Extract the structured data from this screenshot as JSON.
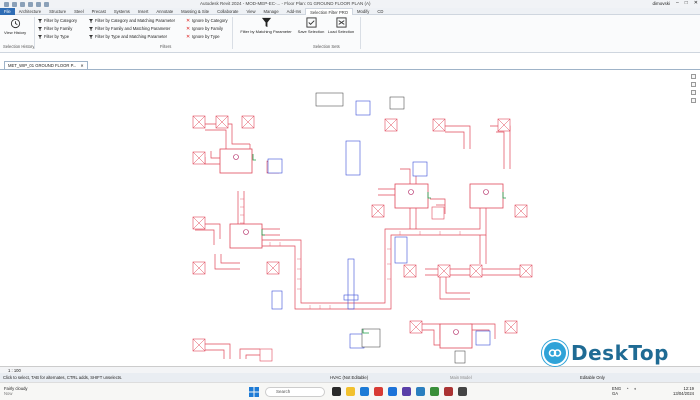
{
  "titlebar": {
    "title": "Autodesk Revit 2024 - MOD-MEP-EC-... - Floor Plan: 01 GROUND FLOOR PLAN (A)",
    "user": "dimovski",
    "qat_icons": [
      "open-icon",
      "save-icon",
      "undo-icon",
      "redo-icon",
      "print-icon",
      "measure-icon"
    ]
  },
  "tabs": [
    "File",
    "Architecture",
    "Structure",
    "Steel",
    "Precast",
    "Systems",
    "Insert",
    "Annotate",
    "Massing & Site",
    "Collaborate",
    "View",
    "Manage",
    "Add-Ins",
    "Selection Filter PRO",
    "Modify",
    "CD"
  ],
  "active_tab": "Selection Filter PRO",
  "ribbon": {
    "view_history": "View History",
    "selection_history_label": "Selection History",
    "col1": [
      "Filter by Category",
      "Filter by Family",
      "Filter by Type"
    ],
    "col2": [
      "Filter by Category and Matching Parameter",
      "Filter by Family and Matching Parameter",
      "Filter by Type and Matching Parameter"
    ],
    "col3": [
      "Ignore by Category",
      "Ignore by Family",
      "Ignore by Type"
    ],
    "filters_label": "Filters",
    "filter_by_param": "Filter by Matching Parameter",
    "save_selection": "Save Selection",
    "load_selection": "Load Selection",
    "selection_sets_label": "Selection Sets"
  },
  "document_tab": "MET_WIP_01 GROUND FLOOR P...",
  "view_bar": {
    "scale": "1 : 100"
  },
  "status": {
    "hint": "Click to select, TAB for alternates, CTRL adds, SHIFT unselects.",
    "workset": "HVAC (Not Editable)",
    "design_option": "Main Model",
    "editable": "Editable Only"
  },
  "taskbar": {
    "weather_title": "Fairly cloudy",
    "weather_sub": "Now",
    "search_placeholder": "Search",
    "tray_lang": "ENG",
    "tray_region": "GA",
    "time": "12:19",
    "date": "13/04/2024"
  },
  "watermark": "DeskTop",
  "colors": {
    "duct": "#e0485a",
    "blue": "#3b4fd8",
    "accent": "#2f6db5"
  }
}
